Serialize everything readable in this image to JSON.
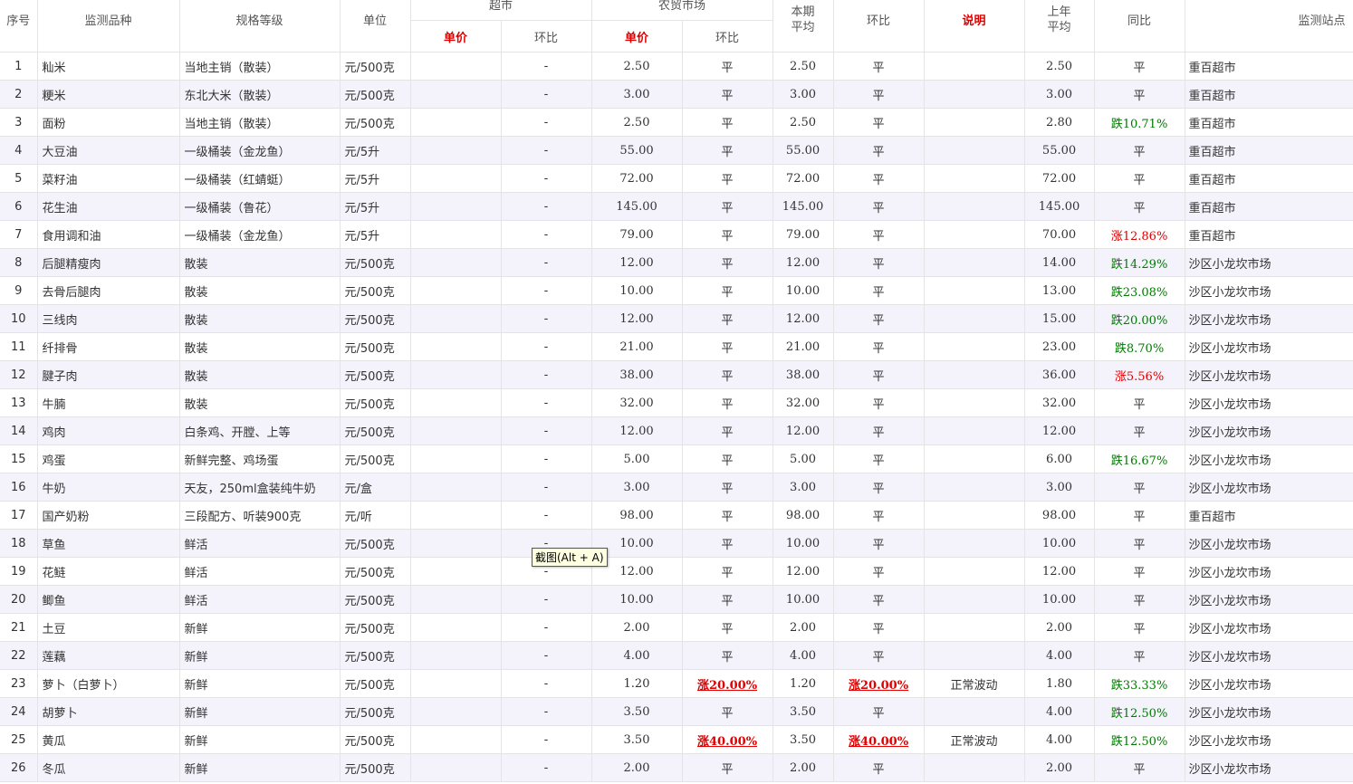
{
  "headers": {
    "seq": "序号",
    "variety": "监测品种",
    "spec": "规格等级",
    "unit": "单位",
    "supermarket": "超市",
    "farmers_market": "农贸市场",
    "period_avg_line1": "本期",
    "period_avg_line2": "平均",
    "mom": "环比",
    "note": "说明",
    "last_year_avg_line1": "上年",
    "last_year_avg_line2": "平均",
    "yoy": "同比",
    "site": "监测站点",
    "sm_price": "单价",
    "sm_mom": "环比",
    "fm_price": "单价",
    "fm_mom": "环比"
  },
  "rows": [
    {
      "no": "1",
      "name": "籼米",
      "spec": "当地主销（散装）",
      "unit": "元/500克",
      "sm_price": "",
      "sm_mom": "-",
      "fm_price": "2.50",
      "fm_mom": "平",
      "avg": "2.50",
      "mom": "平",
      "note": "",
      "ly_avg": "2.50",
      "yoy": "平",
      "site": "重百超市"
    },
    {
      "no": "2",
      "name": "粳米",
      "spec": "东北大米（散装）",
      "unit": "元/500克",
      "sm_price": "",
      "sm_mom": "-",
      "fm_price": "3.00",
      "fm_mom": "平",
      "avg": "3.00",
      "mom": "平",
      "note": "",
      "ly_avg": "3.00",
      "yoy": "平",
      "site": "重百超市"
    },
    {
      "no": "3",
      "name": "面粉",
      "spec": "当地主销（散装）",
      "unit": "元/500克",
      "sm_price": "",
      "sm_mom": "-",
      "fm_price": "2.50",
      "fm_mom": "平",
      "avg": "2.50",
      "mom": "平",
      "note": "",
      "ly_avg": "2.80",
      "yoy": "跌10.71%",
      "site": "重百超市"
    },
    {
      "no": "4",
      "name": "大豆油",
      "spec": "一级桶装（金龙鱼）",
      "unit": "元/5升",
      "sm_price": "",
      "sm_mom": "-",
      "fm_price": "55.00",
      "fm_mom": "平",
      "avg": "55.00",
      "mom": "平",
      "note": "",
      "ly_avg": "55.00",
      "yoy": "平",
      "site": "重百超市"
    },
    {
      "no": "5",
      "name": "菜籽油",
      "spec": "一级桶装（红蜻蜓）",
      "unit": "元/5升",
      "sm_price": "",
      "sm_mom": "-",
      "fm_price": "72.00",
      "fm_mom": "平",
      "avg": "72.00",
      "mom": "平",
      "note": "",
      "ly_avg": "72.00",
      "yoy": "平",
      "site": "重百超市"
    },
    {
      "no": "6",
      "name": "花生油",
      "spec": "一级桶装（鲁花）",
      "unit": "元/5升",
      "sm_price": "",
      "sm_mom": "-",
      "fm_price": "145.00",
      "fm_mom": "平",
      "avg": "145.00",
      "mom": "平",
      "note": "",
      "ly_avg": "145.00",
      "yoy": "平",
      "site": "重百超市"
    },
    {
      "no": "7",
      "name": "食用调和油",
      "spec": "一级桶装（金龙鱼）",
      "unit": "元/5升",
      "sm_price": "",
      "sm_mom": "-",
      "fm_price": "79.00",
      "fm_mom": "平",
      "avg": "79.00",
      "mom": "平",
      "note": "",
      "ly_avg": "70.00",
      "yoy": "涨12.86%",
      "site": "重百超市"
    },
    {
      "no": "8",
      "name": "后腿精瘦肉",
      "spec": "散装",
      "unit": "元/500克",
      "sm_price": "",
      "sm_mom": "-",
      "fm_price": "12.00",
      "fm_mom": "平",
      "avg": "12.00",
      "mom": "平",
      "note": "",
      "ly_avg": "14.00",
      "yoy": "跌14.29%",
      "site": "沙区小龙坎市场"
    },
    {
      "no": "9",
      "name": "去骨后腿肉",
      "spec": "散装",
      "unit": "元/500克",
      "sm_price": "",
      "sm_mom": "-",
      "fm_price": "10.00",
      "fm_mom": "平",
      "avg": "10.00",
      "mom": "平",
      "note": "",
      "ly_avg": "13.00",
      "yoy": "跌23.08%",
      "site": "沙区小龙坎市场"
    },
    {
      "no": "10",
      "name": "三线肉",
      "spec": "散装",
      "unit": "元/500克",
      "sm_price": "",
      "sm_mom": "-",
      "fm_price": "12.00",
      "fm_mom": "平",
      "avg": "12.00",
      "mom": "平",
      "note": "",
      "ly_avg": "15.00",
      "yoy": "跌20.00%",
      "site": "沙区小龙坎市场"
    },
    {
      "no": "11",
      "name": "纤排骨",
      "spec": "散装",
      "unit": "元/500克",
      "sm_price": "",
      "sm_mom": "-",
      "fm_price": "21.00",
      "fm_mom": "平",
      "avg": "21.00",
      "mom": "平",
      "note": "",
      "ly_avg": "23.00",
      "yoy": "跌8.70%",
      "site": "沙区小龙坎市场"
    },
    {
      "no": "12",
      "name": "腱子肉",
      "spec": "散装",
      "unit": "元/500克",
      "sm_price": "",
      "sm_mom": "-",
      "fm_price": "38.00",
      "fm_mom": "平",
      "avg": "38.00",
      "mom": "平",
      "note": "",
      "ly_avg": "36.00",
      "yoy": "涨5.56%",
      "site": "沙区小龙坎市场"
    },
    {
      "no": "13",
      "name": "牛腩",
      "spec": "散装",
      "unit": "元/500克",
      "sm_price": "",
      "sm_mom": "-",
      "fm_price": "32.00",
      "fm_mom": "平",
      "avg": "32.00",
      "mom": "平",
      "note": "",
      "ly_avg": "32.00",
      "yoy": "平",
      "site": "沙区小龙坎市场"
    },
    {
      "no": "14",
      "name": "鸡肉",
      "spec": "白条鸡、开膛、上等",
      "unit": "元/500克",
      "sm_price": "",
      "sm_mom": "-",
      "fm_price": "12.00",
      "fm_mom": "平",
      "avg": "12.00",
      "mom": "平",
      "note": "",
      "ly_avg": "12.00",
      "yoy": "平",
      "site": "沙区小龙坎市场"
    },
    {
      "no": "15",
      "name": "鸡蛋",
      "spec": "新鲜完整、鸡场蛋",
      "unit": "元/500克",
      "sm_price": "",
      "sm_mom": "-",
      "fm_price": "5.00",
      "fm_mom": "平",
      "avg": "5.00",
      "mom": "平",
      "note": "",
      "ly_avg": "6.00",
      "yoy": "跌16.67%",
      "site": "沙区小龙坎市场"
    },
    {
      "no": "16",
      "name": "牛奶",
      "spec": "天友，250ml盒装纯牛奶",
      "unit": "元/盒",
      "sm_price": "",
      "sm_mom": "-",
      "fm_price": "3.00",
      "fm_mom": "平",
      "avg": "3.00",
      "mom": "平",
      "note": "",
      "ly_avg": "3.00",
      "yoy": "平",
      "site": "沙区小龙坎市场"
    },
    {
      "no": "17",
      "name": "国产奶粉",
      "spec": "三段配方、听装900克",
      "unit": "元/听",
      "sm_price": "",
      "sm_mom": "-",
      "fm_price": "98.00",
      "fm_mom": "平",
      "avg": "98.00",
      "mom": "平",
      "note": "",
      "ly_avg": "98.00",
      "yoy": "平",
      "site": "重百超市"
    },
    {
      "no": "18",
      "name": "草鱼",
      "spec": "鲜活",
      "unit": "元/500克",
      "sm_price": "",
      "sm_mom": "-",
      "fm_price": "10.00",
      "fm_mom": "平",
      "avg": "10.00",
      "mom": "平",
      "note": "",
      "ly_avg": "10.00",
      "yoy": "平",
      "site": "沙区小龙坎市场"
    },
    {
      "no": "19",
      "name": "花鲢",
      "spec": "鲜活",
      "unit": "元/500克",
      "sm_price": "",
      "sm_mom": "-",
      "fm_price": "12.00",
      "fm_mom": "平",
      "avg": "12.00",
      "mom": "平",
      "note": "",
      "ly_avg": "12.00",
      "yoy": "平",
      "site": "沙区小龙坎市场"
    },
    {
      "no": "20",
      "name": "鲫鱼",
      "spec": "鲜活",
      "unit": "元/500克",
      "sm_price": "",
      "sm_mom": "-",
      "fm_price": "10.00",
      "fm_mom": "平",
      "avg": "10.00",
      "mom": "平",
      "note": "",
      "ly_avg": "10.00",
      "yoy": "平",
      "site": "沙区小龙坎市场"
    },
    {
      "no": "21",
      "name": "土豆",
      "spec": "新鲜",
      "unit": "元/500克",
      "sm_price": "",
      "sm_mom": "-",
      "fm_price": "2.00",
      "fm_mom": "平",
      "avg": "2.00",
      "mom": "平",
      "note": "",
      "ly_avg": "2.00",
      "yoy": "平",
      "site": "沙区小龙坎市场"
    },
    {
      "no": "22",
      "name": "莲藕",
      "spec": "新鲜",
      "unit": "元/500克",
      "sm_price": "",
      "sm_mom": "-",
      "fm_price": "4.00",
      "fm_mom": "平",
      "avg": "4.00",
      "mom": "平",
      "note": "",
      "ly_avg": "4.00",
      "yoy": "平",
      "site": "沙区小龙坎市场"
    },
    {
      "no": "23",
      "name": "萝卜（白萝卜）",
      "spec": "新鲜",
      "unit": "元/500克",
      "sm_price": "",
      "sm_mom": "-",
      "fm_price": "1.20",
      "fm_mom": "涨20.00%",
      "avg": "1.20",
      "mom": "涨20.00%",
      "note": "正常波动",
      "ly_avg": "1.80",
      "yoy": "跌33.33%",
      "site": "沙区小龙坎市场"
    },
    {
      "no": "24",
      "name": "胡萝卜",
      "spec": "新鲜",
      "unit": "元/500克",
      "sm_price": "",
      "sm_mom": "-",
      "fm_price": "3.50",
      "fm_mom": "平",
      "avg": "3.50",
      "mom": "平",
      "note": "",
      "ly_avg": "4.00",
      "yoy": "跌12.50%",
      "site": "沙区小龙坎市场"
    },
    {
      "no": "25",
      "name": "黄瓜",
      "spec": "新鲜",
      "unit": "元/500克",
      "sm_price": "",
      "sm_mom": "-",
      "fm_price": "3.50",
      "fm_mom": "涨40.00%",
      "avg": "3.50",
      "mom": "涨40.00%",
      "note": "正常波动",
      "ly_avg": "4.00",
      "yoy": "跌12.50%",
      "site": "沙区小龙坎市场"
    },
    {
      "no": "26",
      "name": "冬瓜",
      "spec": "新鲜",
      "unit": "元/500克",
      "sm_price": "",
      "sm_mom": "-",
      "fm_price": "2.00",
      "fm_mom": "平",
      "avg": "2.00",
      "mom": "平",
      "note": "",
      "ly_avg": "2.00",
      "yoy": "平",
      "site": "沙区小龙坎市场"
    }
  ],
  "tooltip": {
    "text": "截图(Alt + A)"
  },
  "colors": {
    "rise": "#e00000",
    "fall": "#007a00",
    "row_alt": "#f4f2fb",
    "tooltip_bg": "#ffffe1"
  }
}
